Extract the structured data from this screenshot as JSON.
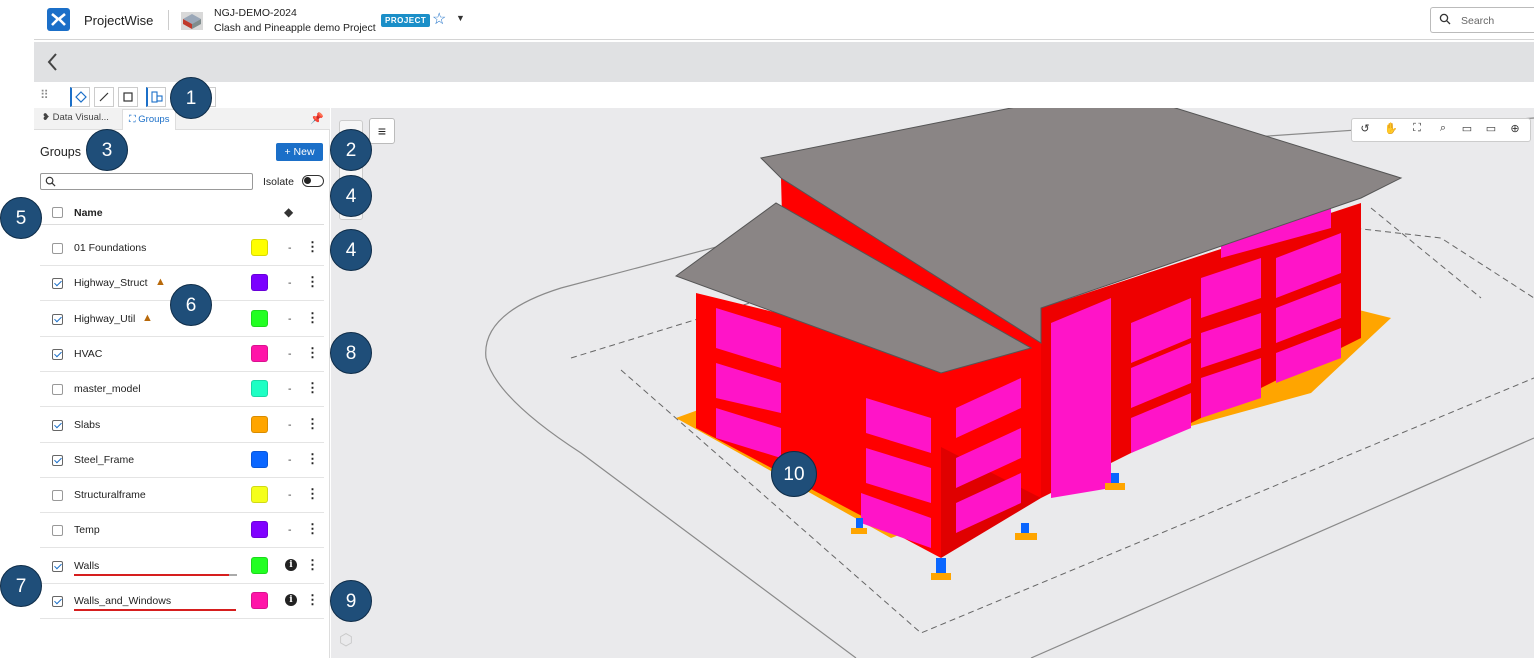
{
  "header": {
    "app_name": "ProjectWise",
    "project_code": "NGJ-DEMO-2024",
    "project_name": "Clash and Pineapple demo Project",
    "project_badge": "PROJECT",
    "search_placeholder": "Search"
  },
  "tools": {
    "icons": [
      "select-icon",
      "line-icon",
      "rectangle-icon",
      "group-tool-icon"
    ]
  },
  "panel": {
    "tabs": [
      {
        "label": "Data Visual..."
      },
      {
        "label": "Groups"
      }
    ],
    "title": "Groups",
    "new_button": "+ New",
    "isolate_label": "Isolate",
    "column_name": "Name",
    "groups": [
      {
        "name": "01 Foundations",
        "checked": false,
        "color": "#FFFF00",
        "status": "-",
        "warning": false
      },
      {
        "name": "Highway_Struct",
        "checked": true,
        "color": "#7B00FF",
        "status": "-",
        "warning": true
      },
      {
        "name": "Highway_Util",
        "checked": true,
        "color": "#22FF22",
        "status": "-",
        "warning": true
      },
      {
        "name": "HVAC",
        "checked": true,
        "color": "#FF14A8",
        "status": "-",
        "warning": false
      },
      {
        "name": "master_model",
        "checked": false,
        "color": "#1DFFC4",
        "status": "-",
        "warning": false
      },
      {
        "name": "Slabs",
        "checked": true,
        "color": "#FFA500",
        "status": "-",
        "warning": false
      },
      {
        "name": "Steel_Frame",
        "checked": true,
        "color": "#0A66FF",
        "status": "-",
        "warning": false
      },
      {
        "name": "Structuralframe",
        "checked": false,
        "color": "#F5FF1A",
        "status": "-",
        "warning": false
      },
      {
        "name": "Temp",
        "checked": false,
        "color": "#8000FF",
        "status": "-",
        "warning": false
      },
      {
        "name": "Walls",
        "checked": true,
        "color": "#22FF22",
        "status": "info",
        "warning": false
      },
      {
        "name": "Walls_and_Windows",
        "checked": true,
        "color": "#FF14A8",
        "status": "info",
        "warning": false
      }
    ]
  },
  "callouts": [
    "1",
    "2",
    "3",
    "4",
    "4",
    "5",
    "6",
    "7",
    "8",
    "9",
    "10"
  ],
  "colors": {
    "accent": "#1b6fc8",
    "callout": "#1f4e79",
    "building_walls": "#ff0000",
    "windows": "#ff14c8",
    "slab": "#ffa500",
    "roof": "#8a8585"
  }
}
